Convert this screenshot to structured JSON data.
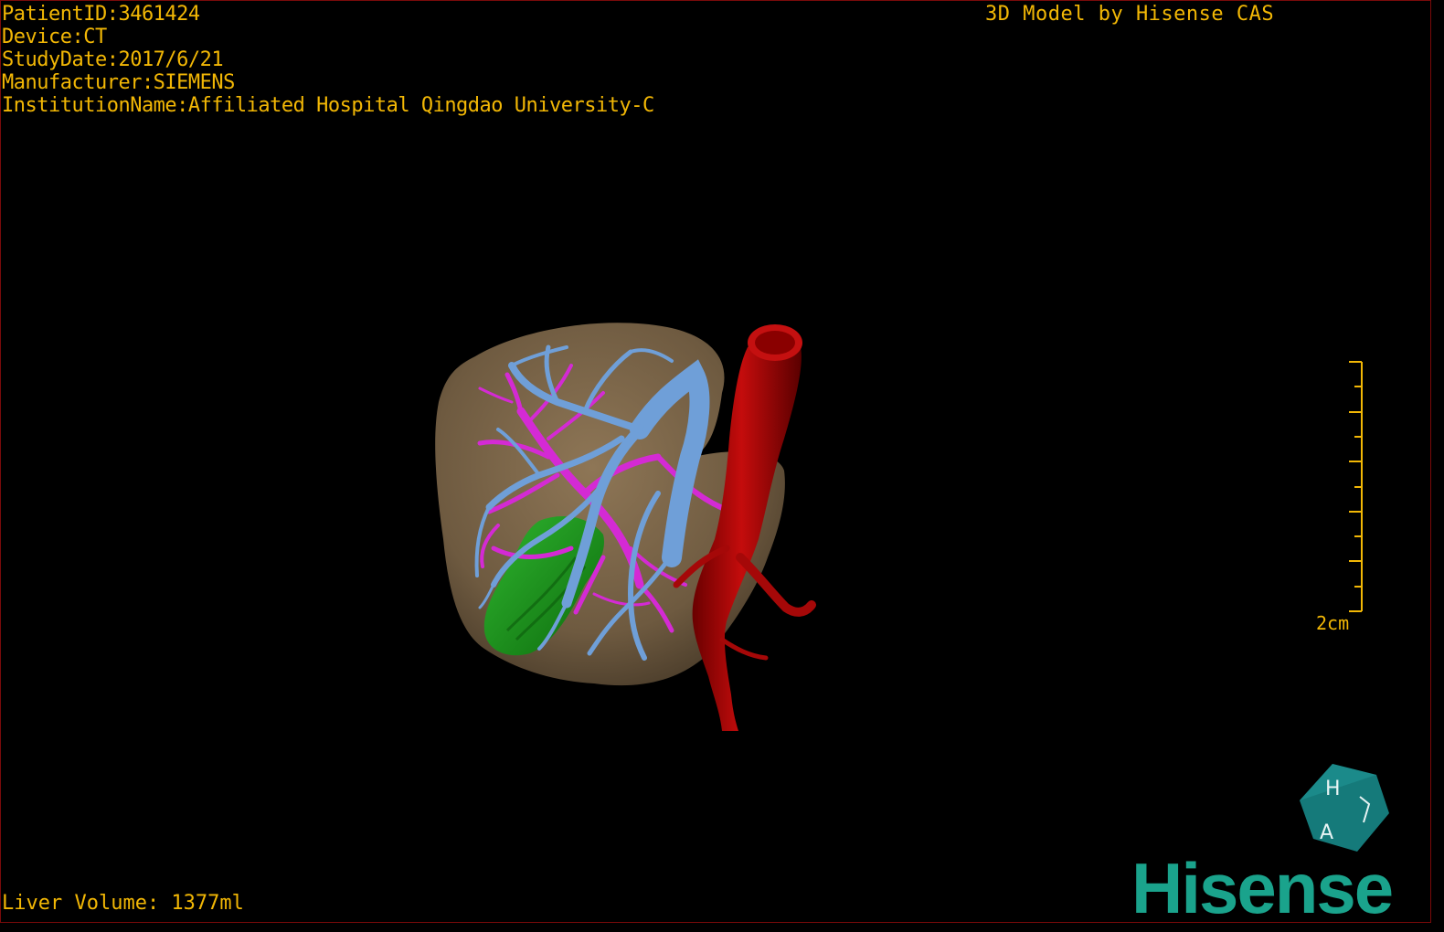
{
  "viewer": {
    "patient_info": {
      "patient_id": "PatientID:3461424",
      "device": "Device:CT",
      "study_date": "StudyDate:2017/6/21",
      "manufacturer": "Manufacturer:SIEMENS",
      "institution": "InstitutionName:Affiliated Hospital Qingdao University-C"
    },
    "credit": "3D Model by Hisense CAS",
    "liver_volume": "Liver Volume: 1377ml",
    "scale_bar": {
      "label": "2cm"
    },
    "orientation_cube": {
      "letters": [
        "H",
        "A"
      ]
    },
    "brand": "Hisense"
  },
  "colors": {
    "overlay_text": "#f2b705",
    "liver": "#7a6448",
    "hepatic_vein": "#6f9fd8",
    "portal_vein": "#d42ad4",
    "gallbladder": "#1f9a1f",
    "aorta": "#b00808",
    "brand": "#1aa38c"
  }
}
